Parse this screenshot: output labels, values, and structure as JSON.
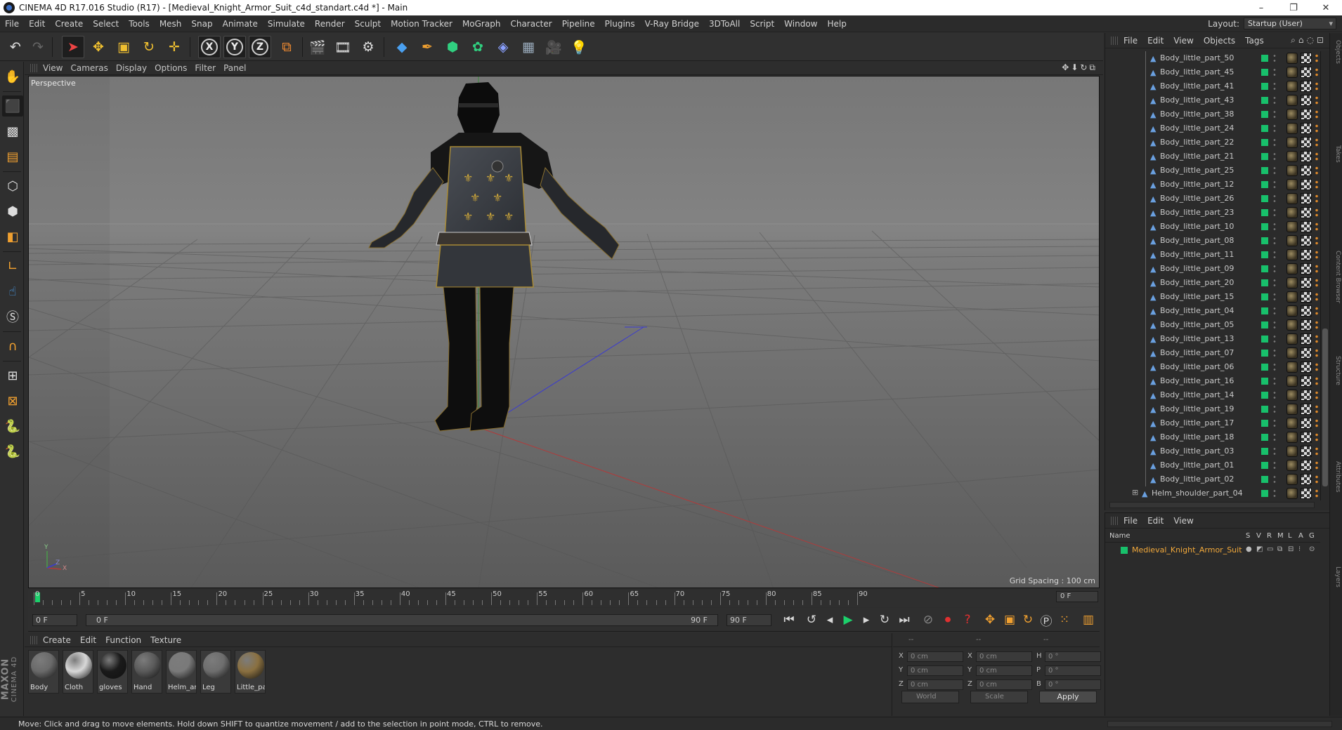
{
  "window": {
    "title": "CINEMA 4D R17.016 Studio (R17) - [Medieval_Knight_Armor_Suit_c4d_standart.c4d *] - Main"
  },
  "menubar": {
    "items": [
      "File",
      "Edit",
      "Create",
      "Select",
      "Tools",
      "Mesh",
      "Snap",
      "Animate",
      "Simulate",
      "Render",
      "Sculpt",
      "Motion Tracker",
      "MoGraph",
      "Character",
      "Pipeline",
      "Plugins",
      "V-Ray Bridge",
      "3DToAll",
      "Script",
      "Window",
      "Help"
    ],
    "layout_label": "Layout:",
    "layout_value": "Startup (User)"
  },
  "toolbar": {
    "icons": [
      "undo-icon",
      "redo-icon",
      "select-arrow-icon",
      "move-icon",
      "scale-icon",
      "rotate-icon",
      "transform-icon",
      "x-axis-icon",
      "y-axis-icon",
      "z-axis-icon",
      "coordinate-system-icon",
      "render-view-icon",
      "render-picture-viewer-icon",
      "render-settings-icon",
      "cube-primitive-icon",
      "pen-spline-icon",
      "subdivision-icon",
      "cloner-icon",
      "deformer-icon",
      "floor-icon",
      "camera-icon",
      "light-icon"
    ],
    "axis_labels": {
      "x": "X",
      "y": "Y",
      "z": "Z"
    }
  },
  "viewport": {
    "menu": [
      "View",
      "Cameras",
      "Display",
      "Options",
      "Filter",
      "Panel"
    ],
    "label": "Perspective",
    "grid_spacing": "Grid Spacing : 100 cm",
    "axis_labels": {
      "y": "Y",
      "x": "X",
      "z": "Z"
    }
  },
  "timeline": {
    "ticks": [
      "0",
      "5",
      "10",
      "15",
      "20",
      "25",
      "30",
      "35",
      "40",
      "45",
      "50",
      "55",
      "60",
      "65",
      "70",
      "75",
      "80",
      "85",
      "90"
    ],
    "current_field": "0 F"
  },
  "playback": {
    "start_field": "0 F",
    "range_start": "0 F",
    "range_end": "90 F",
    "end_field": "90 F"
  },
  "materials": {
    "menu": [
      "Create",
      "Edit",
      "Function",
      "Texture"
    ],
    "items": [
      {
        "name": "Body",
        "color": "#6a6a6a"
      },
      {
        "name": "Cloth",
        "color": "#d8d8d8"
      },
      {
        "name": "gloves",
        "color": "#1a1a1a"
      },
      {
        "name": "Hand",
        "color": "#5a5a5a"
      },
      {
        "name": "Helm_ar",
        "color": "#7a7a7a"
      },
      {
        "name": "Leg",
        "color": "#6e6e6e"
      },
      {
        "name": "Little_pa",
        "color": "#8a7040"
      }
    ]
  },
  "coords": {
    "header": [
      "--",
      "--",
      "--"
    ],
    "rows": [
      {
        "a": "X",
        "av": "0 cm",
        "b": "X",
        "bv": "0 cm",
        "c": "H",
        "cv": "0 °"
      },
      {
        "a": "Y",
        "av": "0 cm",
        "b": "Y",
        "bv": "0 cm",
        "c": "P",
        "cv": "0 °"
      },
      {
        "a": "Z",
        "av": "0 cm",
        "b": "Z",
        "bv": "0 cm",
        "c": "B",
        "cv": "0 °"
      }
    ],
    "mode": "World",
    "scale": "Scale",
    "apply": "Apply"
  },
  "objects": {
    "menu": [
      "File",
      "Edit",
      "View",
      "Objects",
      "Tags"
    ],
    "items": [
      "Body_little_part_50",
      "Body_little_part_45",
      "Body_little_part_41",
      "Body_little_part_43",
      "Body_little_part_38",
      "Body_little_part_24",
      "Body_little_part_22",
      "Body_little_part_21",
      "Body_little_part_25",
      "Body_little_part_12",
      "Body_little_part_26",
      "Body_little_part_23",
      "Body_little_part_10",
      "Body_little_part_08",
      "Body_little_part_11",
      "Body_little_part_09",
      "Body_little_part_20",
      "Body_little_part_15",
      "Body_little_part_04",
      "Body_little_part_05",
      "Body_little_part_13",
      "Body_little_part_07",
      "Body_little_part_06",
      "Body_little_part_16",
      "Body_little_part_14",
      "Body_little_part_19",
      "Body_little_part_17",
      "Body_little_part_18",
      "Body_little_part_03",
      "Body_little_part_01",
      "Body_little_part_02"
    ],
    "last": "Helm_shoulder_part_04"
  },
  "attributes": {
    "menu": [
      "File",
      "Edit",
      "View"
    ],
    "header_name": "Name",
    "columns": [
      "S",
      "V",
      "R",
      "M",
      "L",
      "A",
      "G"
    ],
    "object": "Medieval_Knight_Armor_Suit"
  },
  "status": {
    "text": "Move: Click and drag to move elements. Hold down SHIFT to quantize movement / add to the selection in point mode, CTRL to remove."
  },
  "brand": {
    "maxon": "MAXON",
    "c4d": "CINEMA 4D"
  },
  "right_tabs": [
    "Objects",
    "Takes",
    "Content Browser",
    "Structure",
    "Attributes",
    "Layers"
  ],
  "colors": {
    "accent_green": "#18c06b",
    "object_orange": "#f2a93b"
  }
}
